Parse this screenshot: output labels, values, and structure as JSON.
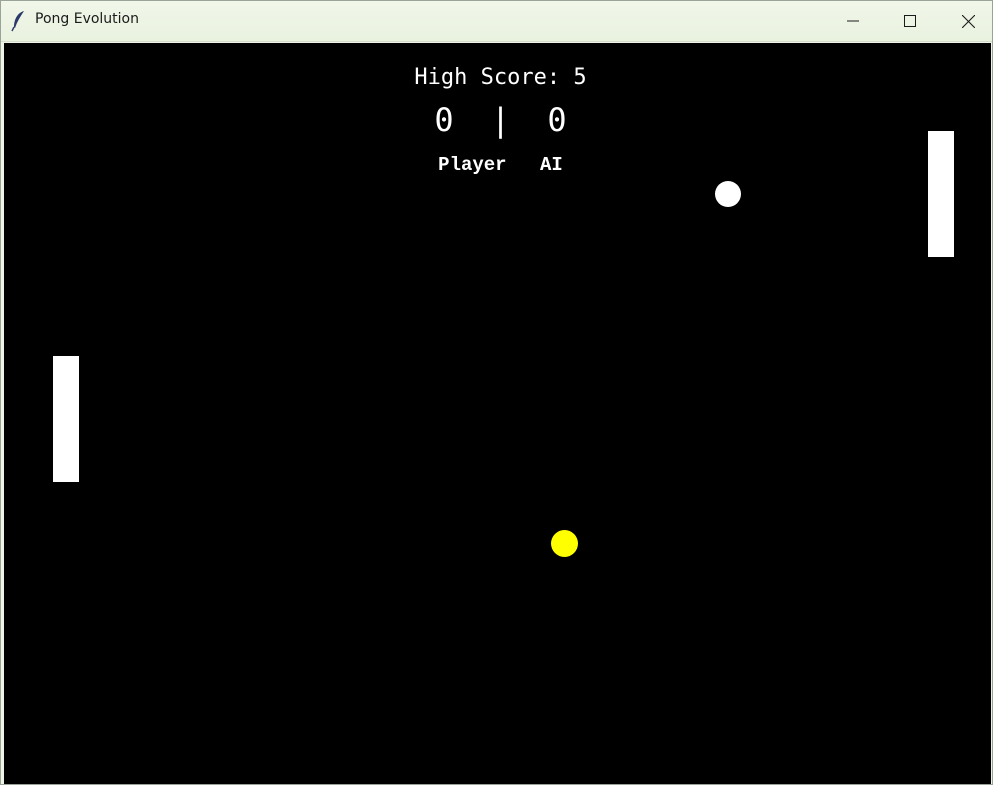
{
  "window": {
    "title": "Pong Evolution",
    "icon": "feather-icon"
  },
  "controls": {
    "minimize_icon": "minimize-icon",
    "maximize_icon": "maximize-icon",
    "close_icon": "close-icon"
  },
  "game": {
    "high_score_text": "High Score: 5",
    "player_score": "0",
    "separator": "|",
    "ai_score": "0",
    "player_label": "Player",
    "ai_label": "AI",
    "colors": {
      "background": "#000000",
      "paddle": "#ffffff",
      "ball_primary": "#ffffff",
      "ball_secondary": "#ffff00"
    }
  }
}
